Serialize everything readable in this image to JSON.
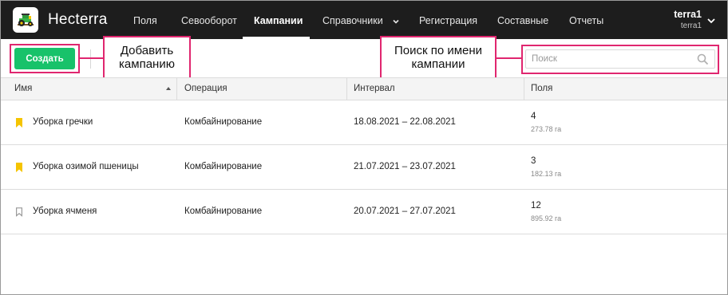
{
  "app": {
    "brand": "Hecterra",
    "nav": [
      {
        "label": "Поля"
      },
      {
        "label": "Севооборот"
      },
      {
        "label": "Кампании",
        "active": true
      },
      {
        "label": "Справочники",
        "has_dropdown": true
      },
      {
        "label": "Регистрация"
      },
      {
        "label": "Составные"
      },
      {
        "label": "Отчеты"
      }
    ],
    "user": {
      "name": "terra1",
      "account": "terra1"
    }
  },
  "toolbar": {
    "create_label": "Создать",
    "search_placeholder": "Поиск"
  },
  "annotations": {
    "add_campaign": "Добавить кампанию",
    "search_by_name": "Поиск по имени кампании"
  },
  "table": {
    "columns": [
      "Имя",
      "Операция",
      "Интервал",
      "Поля"
    ],
    "sort_column": "Имя",
    "rows": [
      {
        "name": "Уборка гречки",
        "operation": "Комбайнирование",
        "interval": "18.08.2021 – 22.08.2021",
        "fields_count": "4",
        "fields_area": "273.78 га",
        "bookmarked": true
      },
      {
        "name": "Уборка озимой пшеницы",
        "operation": "Комбайнирование",
        "interval": "21.07.2021 – 23.07.2021",
        "fields_count": "3",
        "fields_area": "182.13 га",
        "bookmarked": true
      },
      {
        "name": "Уборка ячменя",
        "operation": "Комбайнирование",
        "interval": "20.07.2021 – 27.07.2021",
        "fields_count": "12",
        "fields_area": "895.92 га",
        "bookmarked": false
      }
    ]
  },
  "colors": {
    "nav_bg": "#1d1d1d",
    "accent_green": "#18c26a",
    "bookmark_yellow": "#f5c400",
    "annotation_pink": "#e0266f"
  },
  "icons": {
    "logo": "tractor-logo-icon",
    "search": "search-icon",
    "sort": "sort-asc-icon",
    "bookmark_filled": "bookmark-filled-icon",
    "bookmark_outline": "bookmark-outline-icon",
    "chevron": "chevron-down-icon"
  }
}
